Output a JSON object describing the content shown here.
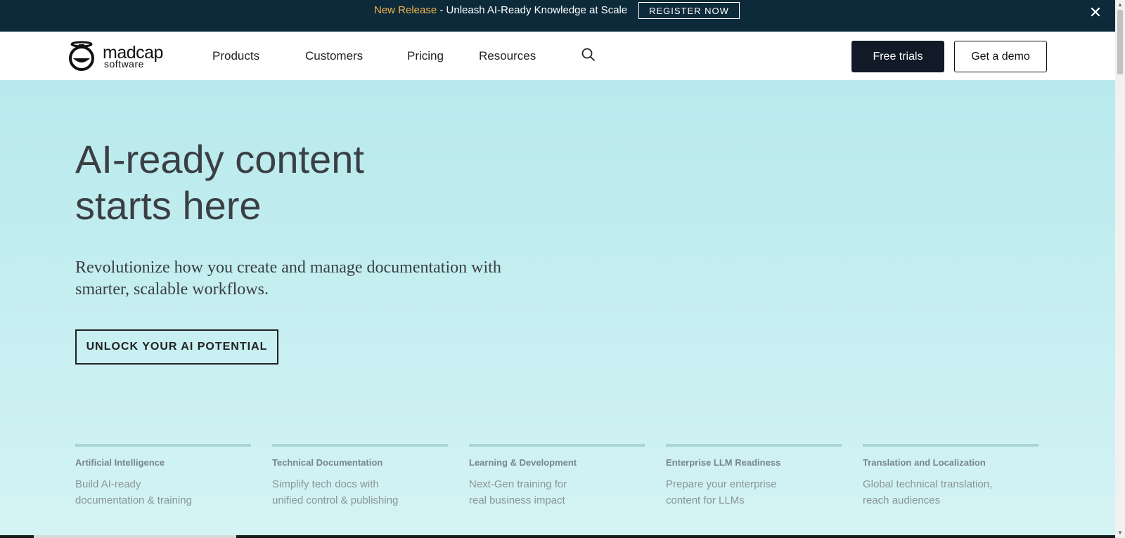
{
  "announcement": {
    "highlight": "New Release",
    "text": " - Unleash AI-Ready Knowledge at Scale",
    "button": "REGISTER NOW",
    "close_icon": "close-icon"
  },
  "header": {
    "logo_line1": "madcap",
    "logo_line2": "software",
    "nav": [
      "Products",
      "Customers",
      "Pricing",
      "Resources"
    ],
    "search_icon": "search-icon",
    "free_trials": "Free trials",
    "get_demo": "Get a demo"
  },
  "hero": {
    "title_line1": "AI-ready content",
    "title_line2": "starts here",
    "subtitle": "Revolutionize how you create and manage documentation with smarter, scalable workflows.",
    "cta": "UNLOCK YOUR AI POTENTIAL"
  },
  "cards": [
    {
      "category": "Artificial Intelligence",
      "line1": "Build AI-ready",
      "line2": "documentation & training"
    },
    {
      "category": "Technical Documentation",
      "line1": "Simplify tech docs with",
      "line2": "unified control & publishing"
    },
    {
      "category": "Learning & Development",
      "line1": "Next-Gen training for",
      "line2": "real business impact"
    },
    {
      "category": "Enterprise LLM Readiness",
      "line1": "Prepare your enterprise",
      "line2": "content for LLMs"
    },
    {
      "category": "Translation and Localization",
      "line1": "Global technical translation,",
      "line2": "reach audiences"
    }
  ],
  "colors": {
    "announce_bg": "#0d2a3a",
    "accent": "#f3b64a",
    "hero_bg": "#c6eef0",
    "button_dark": "#111a26"
  }
}
